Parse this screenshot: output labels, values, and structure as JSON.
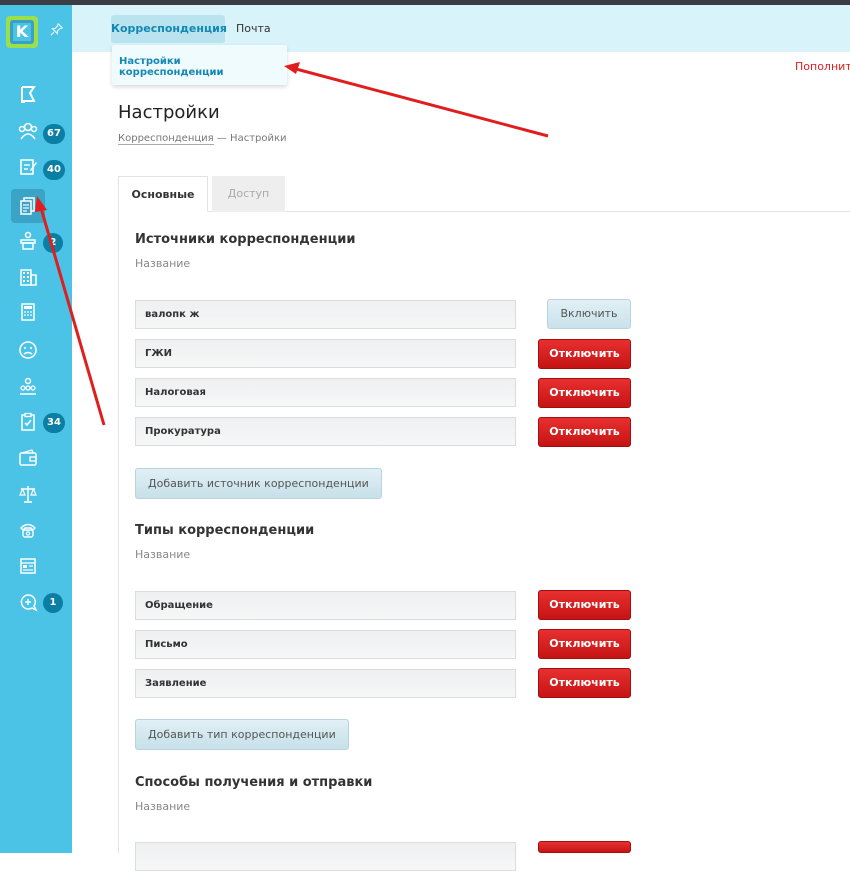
{
  "sidebar": {
    "logo_letter": "K",
    "badges": {
      "residents": "67",
      "requests": "40",
      "meetings": "2",
      "tasks": "34",
      "chat": "1"
    }
  },
  "topmenu": {
    "tab_correspondence": "Корреспонденция",
    "tab_mail": "Почта",
    "submenu_settings": "Настройки корреспонденции",
    "top_right_link": "Пополнит"
  },
  "header": {
    "title": "Настройки",
    "breadcrumb_link": "Корреспонденция",
    "breadcrumb_current": " — Настройки"
  },
  "tabs": {
    "main": "Основные",
    "access": "Доступ"
  },
  "sources": {
    "title": "Источники корреспонденции",
    "column": "Название",
    "rows": [
      {
        "name": "валопк ж",
        "action": "Включить"
      },
      {
        "name": "ГЖИ",
        "action": "Отключить"
      },
      {
        "name": "Налоговая",
        "action": "Отключить"
      },
      {
        "name": "Прокуратура",
        "action": "Отключить"
      }
    ],
    "add_button": "Добавить источник корреспонденции"
  },
  "types": {
    "title": "Типы корреспонденции",
    "column": "Название",
    "rows": [
      {
        "name": "Обращение",
        "action": "Отключить"
      },
      {
        "name": "Письмо",
        "action": "Отключить"
      },
      {
        "name": "Заявление",
        "action": "Отключить"
      }
    ],
    "add_button": "Добавить тип корреспонденции"
  },
  "methods": {
    "title": "Способы получения и отправки",
    "column": "Название"
  },
  "colors": {
    "sidebar": "#4bc3e6",
    "accent": "#1388b5",
    "danger": "#d11c1c",
    "arrow": "#e01e1e"
  }
}
